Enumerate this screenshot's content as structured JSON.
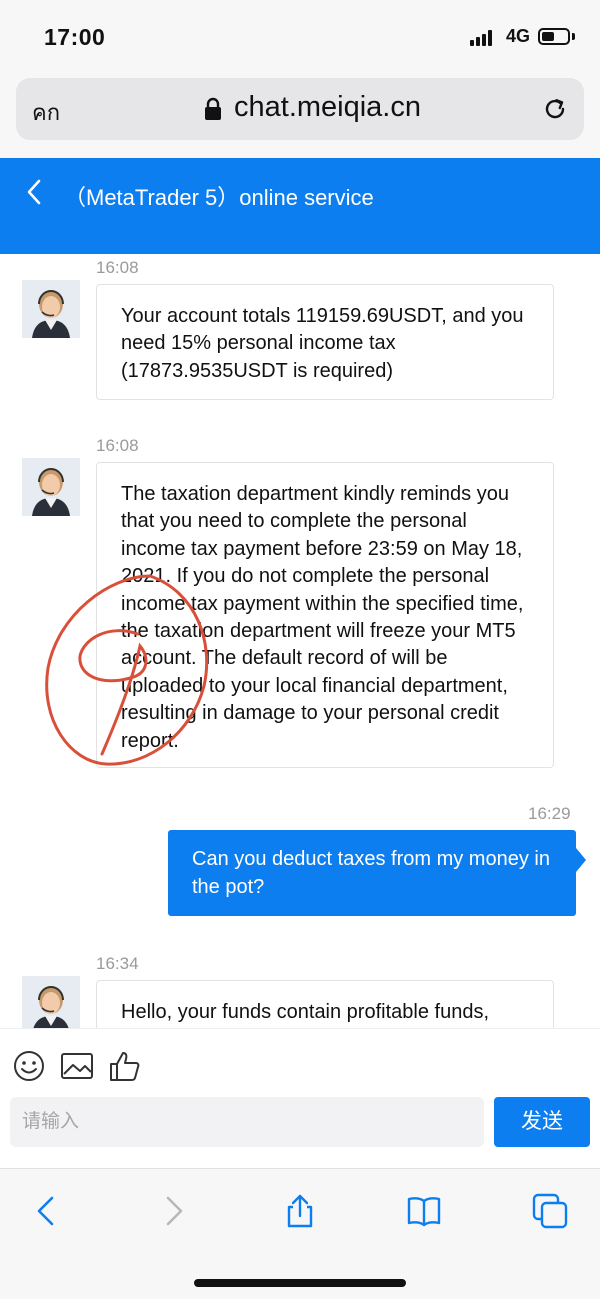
{
  "status_bar": {
    "time": "17:00",
    "network": "4G"
  },
  "browser": {
    "text_size_label": "คก",
    "url": "chat.meiqia.cn"
  },
  "chat_header": {
    "title": "（MetaTrader 5）online service"
  },
  "messages": [
    {
      "direction": "incoming",
      "time": "16:08",
      "text": "Your account totals 119159.69USDT, and you need 15% personal income tax (17873.9535USDT is required)"
    },
    {
      "direction": "incoming",
      "time": "16:08",
      "text": "The taxation department kindly reminds you that you need to complete the personal income tax payment before 23:59 on May 18, 2021. If you do not complete the personal income tax payment within the specified time, the taxation department will freeze your MT5 account. The default record of will be uploaded to your local financial department, resulting in damage to your personal credit report."
    },
    {
      "direction": "outgoing",
      "time": "16:29",
      "text": "Can you deduct taxes from my money in the pot?"
    },
    {
      "direction": "incoming",
      "time": "16:34",
      "text": "Hello, your funds contain profitable funds,"
    }
  ],
  "composer": {
    "placeholder": "请输入",
    "send_label": "发送"
  },
  "colors": {
    "accent": "#0d7ef0",
    "annotation": "#d9503a"
  }
}
